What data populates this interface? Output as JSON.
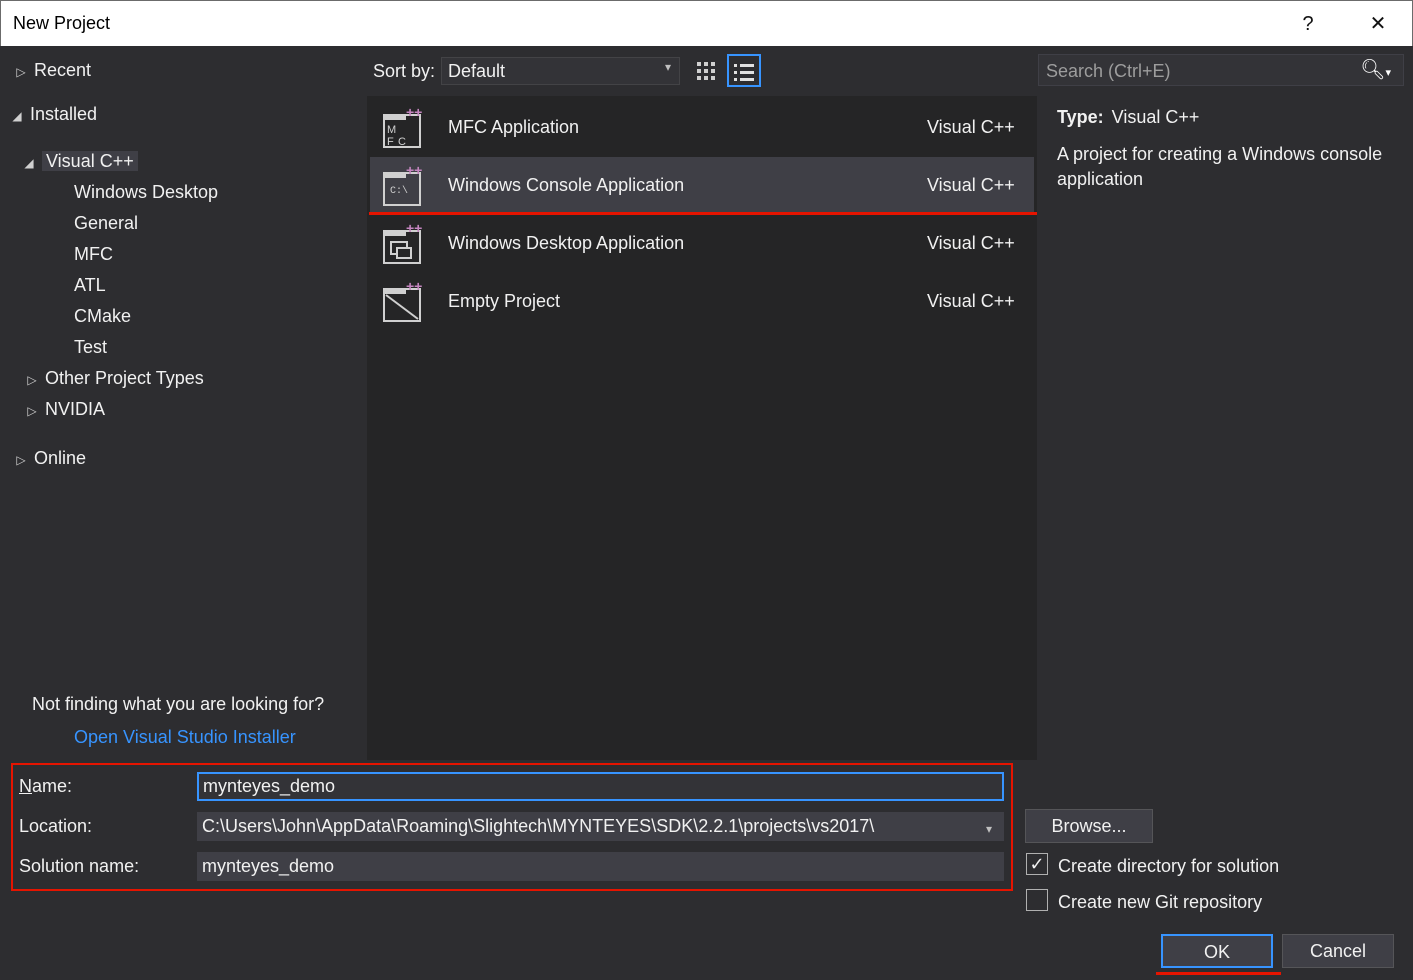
{
  "window": {
    "title": "New Project",
    "help": "?",
    "close": "✕"
  },
  "sidebar": {
    "recent": "Recent",
    "installed": "Installed",
    "visual_cpp": "Visual C++",
    "children": [
      "Windows Desktop",
      "General",
      "MFC",
      "ATL",
      "CMake",
      "Test"
    ],
    "other_project_types": "Other Project Types",
    "nvidia": "NVIDIA",
    "online": "Online",
    "hint": "Not finding what you are looking for?",
    "installer_link": "Open Visual Studio Installer"
  },
  "toolbar": {
    "sort_label": "Sort by:",
    "sort_value": "Default"
  },
  "templates": [
    {
      "name": "MFC Application",
      "lang": "Visual C++",
      "icon": "mfc-icon",
      "selected": false
    },
    {
      "name": "Windows Console Application",
      "lang": "Visual C++",
      "icon": "console-icon",
      "selected": true
    },
    {
      "name": "Windows Desktop Application",
      "lang": "Visual C++",
      "icon": "desktop-app-icon",
      "selected": false
    },
    {
      "name": "Empty Project",
      "lang": "Visual C++",
      "icon": "empty-project-icon",
      "selected": false
    }
  ],
  "search": {
    "placeholder": "Search (Ctrl+E)"
  },
  "details": {
    "type_label": "Type:",
    "type_value": "Visual C++",
    "description": "A project for creating a Windows console application"
  },
  "form": {
    "name_label": "Name:",
    "name_value": "mynteyes_demo",
    "location_label": "Location:",
    "location_value": "C:\\Users\\John\\AppData\\Roaming\\Slightech\\MYNTEYES\\SDK\\2.2.1\\projects\\vs2017\\",
    "solution_label": "Solution name:",
    "solution_value": "mynteyes_demo",
    "browse": "Browse...",
    "create_dir": "Create directory for solution",
    "create_dir_checked": true,
    "create_git": "Create new Git repository",
    "create_git_checked": false,
    "ok": "OK",
    "cancel": "Cancel"
  },
  "colors": {
    "accent": "#3794ff",
    "highlight": "#e51400",
    "plus": "#c586c0"
  }
}
